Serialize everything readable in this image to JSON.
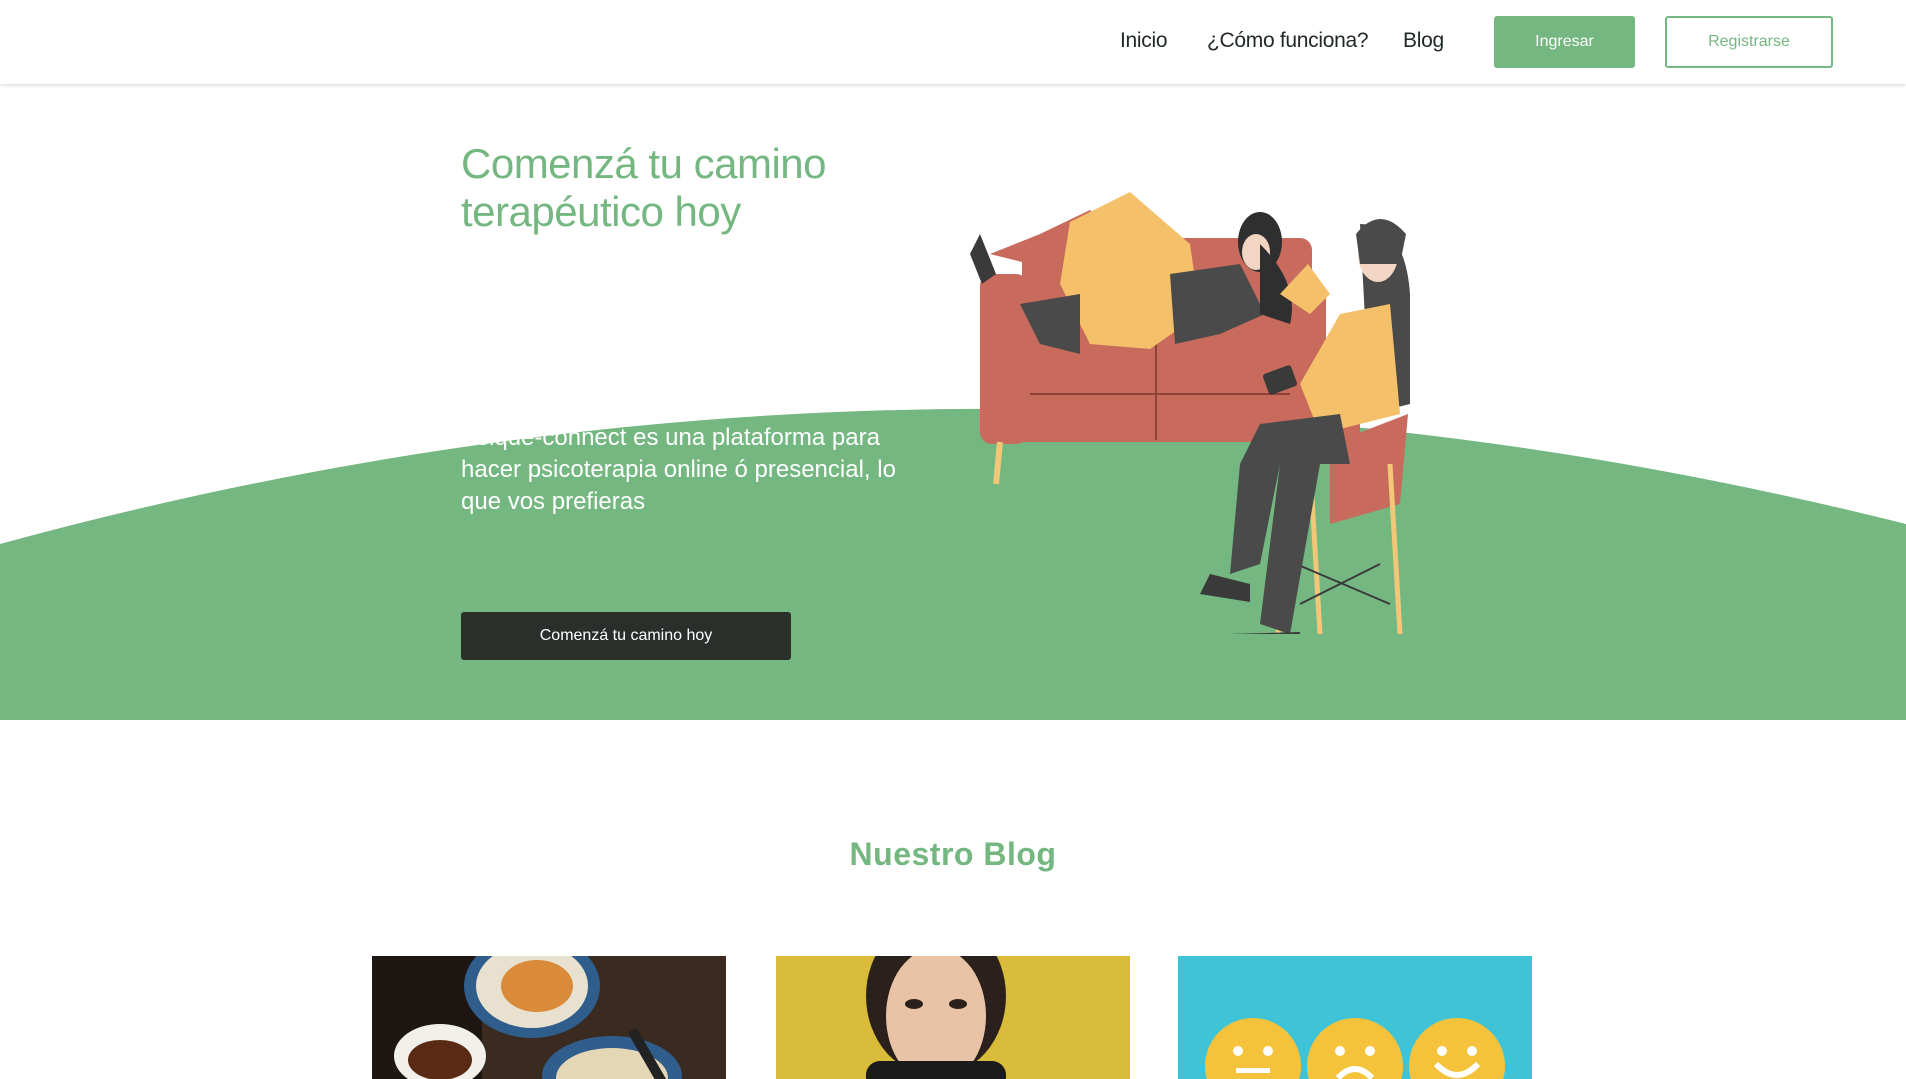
{
  "header": {
    "nav": [
      {
        "label": "Inicio"
      },
      {
        "label": "¿Cómo funciona?"
      },
      {
        "label": "Blog"
      }
    ],
    "login_label": "Ingresar",
    "register_label": "Registrarse"
  },
  "hero": {
    "title": "Comenzá tu camino terapéutico hoy",
    "description": "Psique-connect es una plataforma para hacer psicoterapia online ó presencial, lo que vos prefieras",
    "cta_label": "Comenzá tu camino hoy"
  },
  "blog": {
    "title": "Nuestro Blog",
    "cards": [
      {
        "image": "breakfast-photo"
      },
      {
        "image": "woman-portrait-photo"
      },
      {
        "image": "smiley-faces-photo"
      }
    ]
  },
  "colors": {
    "brand_green": "#74b780",
    "dark": "#2b2f2c"
  }
}
